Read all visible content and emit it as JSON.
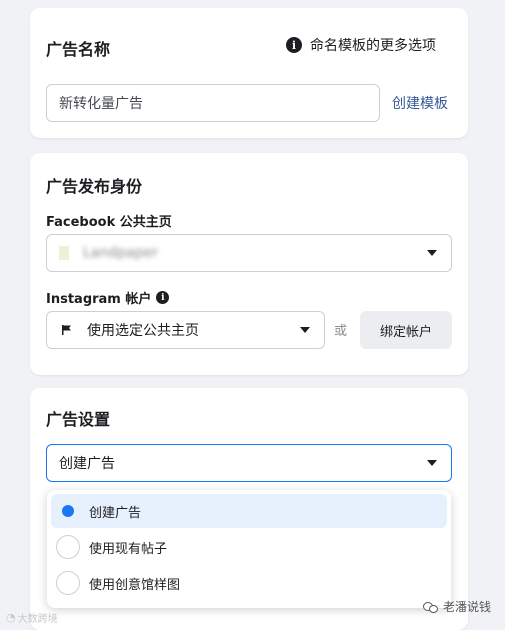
{
  "ad_name": {
    "title": "广告名称",
    "naming_template_link": "命名模板的更多选项",
    "name_value": "新转化量广告",
    "create_template_link": "创建模板"
  },
  "identity": {
    "title": "广告发布身份",
    "facebook_label": "Facebook 公共主页",
    "facebook_page_value": "Landpaper",
    "instagram_label": "Instagram 帐户",
    "instagram_select_value": "使用选定公共主页",
    "or_text": "或",
    "bind_account_button": "绑定帐户"
  },
  "settings": {
    "title": "广告设置",
    "select_value": "创建广告",
    "options": [
      {
        "label": "创建广告",
        "selected": true
      },
      {
        "label": "使用现有帖子",
        "selected": false
      },
      {
        "label": "使用创意馆样图",
        "selected": false
      }
    ]
  },
  "watermarks": {
    "left": "大数跨境",
    "right": "老潘说钱"
  },
  "colors": {
    "link": "#385898",
    "radio_selected": "#1877f2",
    "selected_row": "#e7f0fd",
    "page_bg": "#f0f2f5"
  }
}
